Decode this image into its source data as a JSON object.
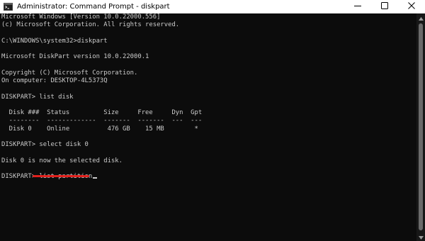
{
  "window": {
    "title": "Administrator: Command Prompt - diskpart",
    "icon": "cmd-icon",
    "controls": [
      "minimize-icon",
      "maximize-icon",
      "close-icon"
    ]
  },
  "console": {
    "lines": [
      "Microsoft Windows [Version 10.0.22000.556]",
      "(c) Microsoft Corporation. All rights reserved.",
      "",
      "C:\\WINDOWS\\system32>diskpart",
      "",
      "Microsoft DiskPart version 10.0.22000.1",
      "",
      "Copyright (C) Microsoft Corporation.",
      "On computer: DESKTOP-4L5373Q",
      "",
      "DISKPART> list disk",
      "",
      "  Disk ###  Status         Size     Free     Dyn  Gpt",
      "  --------  -------------  -------  -------  ---  ---",
      "  Disk 0    Online          476 GB    15 MB        *",
      "",
      "DISKPART> select disk 0",
      "",
      "Disk 0 is now the selected disk.",
      "",
      "DISKPART> list partition"
    ]
  },
  "colors": {
    "console_bg": "#0c0c0c",
    "console_text": "#cccccc",
    "highlight_underline": "#e0201c"
  }
}
